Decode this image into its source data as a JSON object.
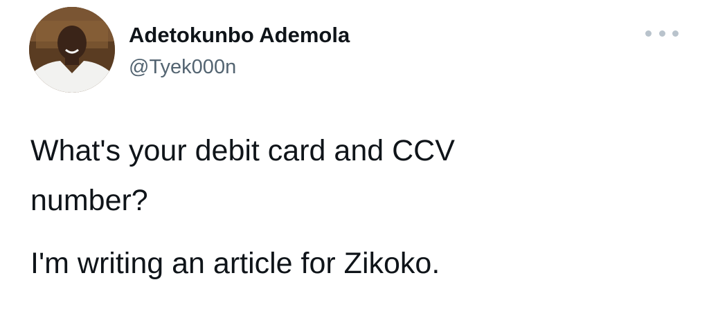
{
  "tweet": {
    "author": {
      "display_name": "Adetokunbo Ademola",
      "handle": "@Tyek000n",
      "avatar_icon": "profile-photo"
    },
    "more_icon": "more-options-icon",
    "text_lines": [
      "What's your debit card and CCV",
      "number?",
      "I'm writing an article for Zikoko."
    ]
  },
  "colors": {
    "text_primary": "#0f1419",
    "text_secondary": "#536471",
    "more_dots": "#b9c3cc",
    "background": "#ffffff"
  }
}
